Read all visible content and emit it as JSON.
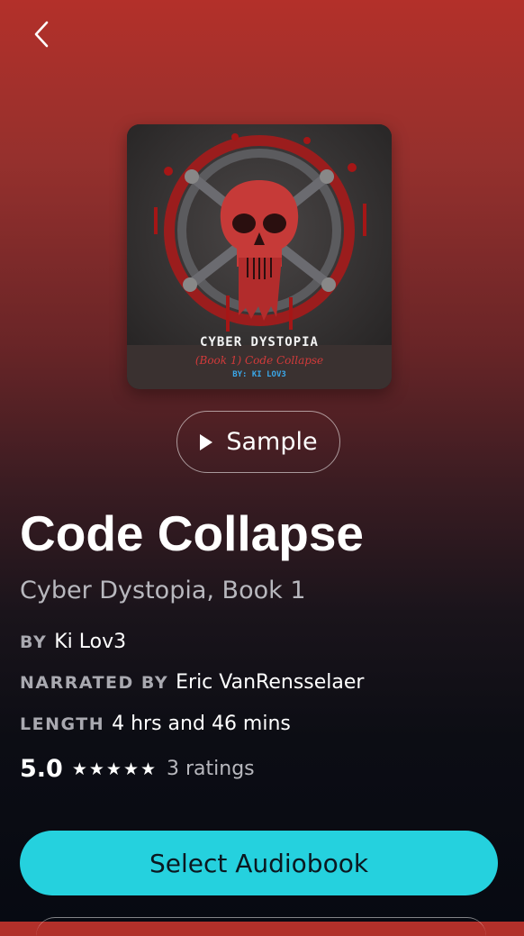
{
  "nav": {
    "back_icon": "chevron-left-icon"
  },
  "cover": {
    "title": "CYBER DYSTOPIA",
    "subtitle": "(Book 1) Code Collapse",
    "author": "BY: KI LOV3"
  },
  "sample": {
    "label": "Sample",
    "icon": "play-icon"
  },
  "book": {
    "title": "Code Collapse",
    "series": "Cyber Dystopia, Book 1",
    "by_label": "BY",
    "author": "Ki Lov3",
    "narrated_label": "NARRATED BY",
    "narrator": "Eric VanRensselaer",
    "length_label": "LENGTH",
    "length": "4 hrs and 46 mins",
    "rating": "5.0",
    "stars": "★★★★★",
    "ratings_count": "3 ratings"
  },
  "cta": {
    "label": "Select Audiobook",
    "color": "#25d1de"
  }
}
